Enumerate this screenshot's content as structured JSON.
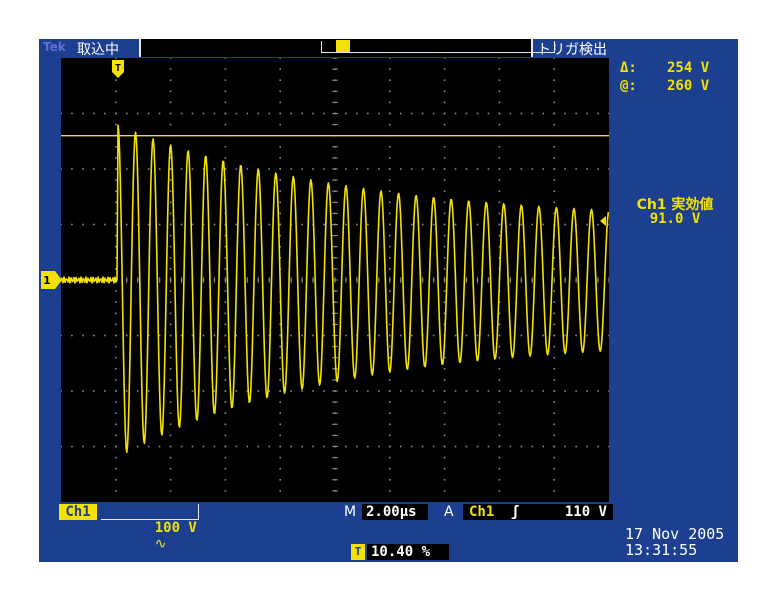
{
  "top_bar": {
    "brand": "Tek",
    "acquisition_status": "取込中",
    "trigger_status": "トリガ検出"
  },
  "readouts": {
    "delta_symbol": "Δ:",
    "delta_value": "254 V",
    "at_symbol": "@:",
    "at_value": "260 V",
    "measurement_label": "Ch1 実効値",
    "measurement_value": "91.0 V"
  },
  "markers": {
    "channel_marker": "1",
    "trigger_marker": "T"
  },
  "bottom_bar": {
    "channel_badge": "Ch1",
    "channel_scale": "100 V",
    "coupling_symbol": "∿",
    "timebase_letter": "M",
    "timebase_value": "2.00µs",
    "trigger_letter": "A",
    "trigger_source": "Ch1",
    "trigger_slope_symbol": "ʃ",
    "trigger_level": "110 V",
    "position_icon": "T",
    "position_value": "10.40 %",
    "date": "17 Nov 2005",
    "time": "13:31:55"
  },
  "colors": {
    "background": "#1c3f8f",
    "screen": "#000000",
    "trace": "#f3e100",
    "text": "#ffffff"
  },
  "waveform": {
    "description_type": "decaying sinusoid",
    "cycles": 28,
    "trigger_position_percent": 10.4,
    "peak_first_V": 260,
    "peak_last_V": 105,
    "cursor_level_V": 260,
    "cursor_span_V": 254
  }
}
